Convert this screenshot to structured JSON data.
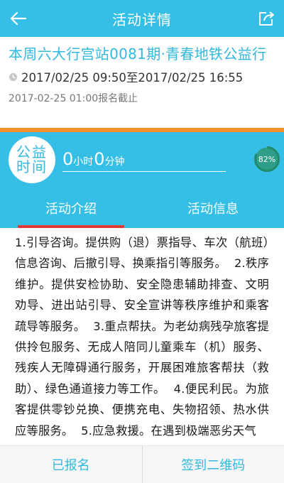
{
  "navbar": {
    "title": "活动详情",
    "back_icon": "back-arrow-icon",
    "share_icon": "share-icon"
  },
  "activity": {
    "title": "本周六大行宫站0081期·青春地铁公益行",
    "time_range": "2017/02/25 09:50至2017/02/25 16:55",
    "deadline": "2017-02-25 01:00报名截止",
    "time_icon": "clock-icon"
  },
  "hours": {
    "badge_text": "公益时间",
    "hours_value": "0",
    "hours_unit": "小时",
    "minutes_value": "0",
    "minutes_unit": "分钟",
    "progress_percent": 82,
    "progress_label": "82%"
  },
  "tabs": [
    {
      "label": "活动介绍",
      "active": true
    },
    {
      "label": "活动信息",
      "active": false
    }
  ],
  "content": {
    "text": "1.引导咨询。提供购（退）票指导、车次（航班）信息咨询、后撤引导、换乘指引等服务。  2.秩序维护。提供安检协助、安全隐患辅助排查、文明劝导、进出站引导、安全宣讲等秩序维护和乘客疏导等服务。  3.重点帮扶。为老幼病残孕旅客提供拎包服务、无成人陪同儿童乘车（机）服务、残疾人无障碍通行服务，开展困难旅客帮扶（救助）、绿色通道接力等工作。  4.便民利民。为旅客提供零钞兑换、便携充电、失物招领、热水供应等服务。  5.应急救援。在遇到极端恶劣天气"
  },
  "bottom": {
    "registered_label": "已报名",
    "checkin_label": "签到二维码"
  },
  "colors": {
    "primary": "#35bfe6",
    "accent_orange": "#f5902a",
    "tab_indicator": "#e53935",
    "progress": "#2e9e88"
  }
}
